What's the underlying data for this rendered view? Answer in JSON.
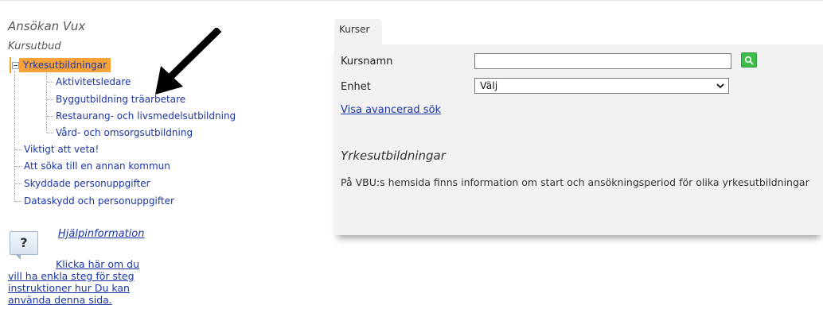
{
  "app": {
    "title": "Ansökan Vux"
  },
  "sidebar": {
    "section_title": "Kursutbud",
    "tree": {
      "selected": "Yrkesutbildningar",
      "children": [
        "Aktivitetsledare",
        "Byggutbildning träarbetare",
        "Restaurang- och livsmedelsutbildning",
        "Vård- och omsorgsutbildning"
      ],
      "siblings": [
        "Viktigt att veta!",
        "Att söka till en annan kommun",
        "Skyddade personuppgifter",
        "Dataskydd och personuppgifter"
      ]
    },
    "help": {
      "link": "Hjälpinformation",
      "line1": "Klicka här om du",
      "line2": "vill ha enkla steg för steg",
      "line3": "instruktioner hur Du kan",
      "line4": "använda denna sida."
    }
  },
  "main": {
    "tab": "Kurser",
    "course_name_label": "Kursnamn",
    "course_name_value": "",
    "unit_label": "Enhet",
    "unit_selected": "Välj",
    "advanced_search": "Visa avancerad sök",
    "heading": "Yrkesutbildningar",
    "info": "På VBU:s hemsida finns information om start och ansökningsperiod för olika yrkesutbildningar"
  },
  "colors": {
    "link": "#1a35a8",
    "selected_bg": "#f7a33a",
    "search_button": "#3dbd4a",
    "panel_bg": "#f2f2f2"
  },
  "icons": [
    "tree-collapse-icon",
    "search-icon",
    "chevron-down-icon",
    "help-question-icon",
    "annotation-arrow"
  ]
}
